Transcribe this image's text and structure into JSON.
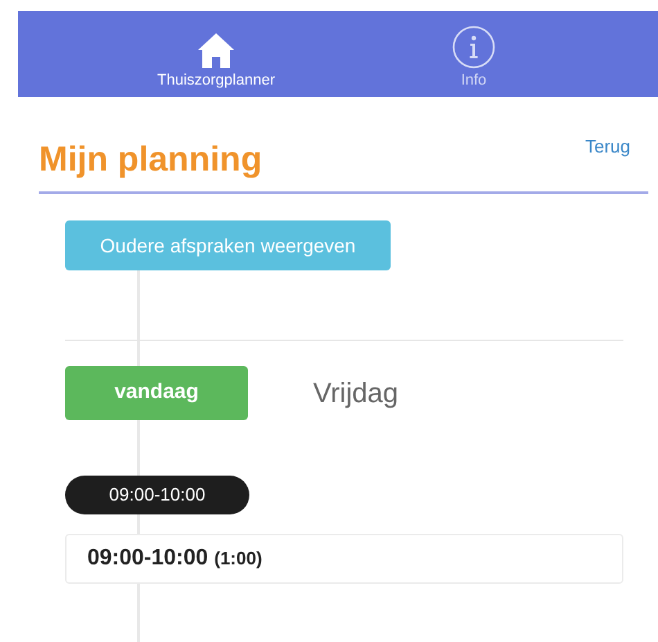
{
  "tabs": [
    {
      "label": "Thuiszorgplanner",
      "kind": "home",
      "selected": true
    },
    {
      "label": "Info",
      "kind": "info",
      "selected": false
    }
  ],
  "page": {
    "title": "Mijn planning",
    "back_link": "Terug"
  },
  "older_button": "Oudere afspraken weergeven",
  "day": {
    "badge": "vandaag",
    "name": "Vrijdag"
  },
  "appointments": [
    {
      "time_pill": "09:00-10:00",
      "time": "09:00-10:00",
      "duration": "(1:00)"
    }
  ]
}
